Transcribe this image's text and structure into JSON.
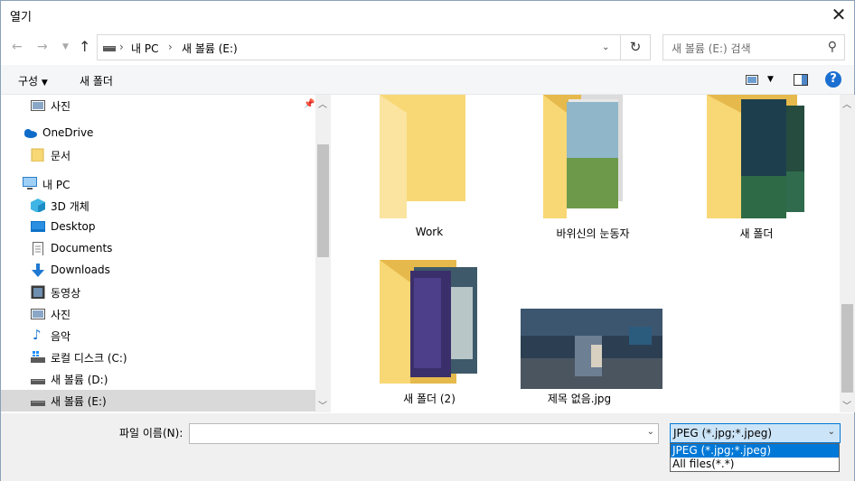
{
  "window": {
    "title": "열기"
  },
  "nav": {
    "breadcrumb": [
      "내 PC",
      "새 볼륨 (E:)"
    ],
    "search_placeholder": "새 볼륨 (E:) 검색"
  },
  "toolbar": {
    "organize": "구성",
    "new_folder": "새 폴더"
  },
  "sidebar": {
    "items": [
      {
        "label": "사진",
        "icon": "pictures-icon"
      },
      {
        "label": "OneDrive",
        "icon": "onedrive-icon"
      },
      {
        "label": "문서",
        "icon": "folder-icon"
      },
      {
        "label": "내 PC",
        "icon": "pc-icon"
      },
      {
        "label": "3D 개체",
        "icon": "3d-objects-icon"
      },
      {
        "label": "Desktop",
        "icon": "desktop-icon"
      },
      {
        "label": "Documents",
        "icon": "documents-icon"
      },
      {
        "label": "Downloads",
        "icon": "downloads-icon"
      },
      {
        "label": "동영상",
        "icon": "videos-icon"
      },
      {
        "label": "사진",
        "icon": "pictures-icon"
      },
      {
        "label": "음악",
        "icon": "music-icon"
      },
      {
        "label": "로컬 디스크 (C:)",
        "icon": "drive-c-icon"
      },
      {
        "label": "새 볼륨 (D:)",
        "icon": "drive-icon"
      },
      {
        "label": "새 볼륨 (E:)",
        "icon": "drive-icon"
      }
    ]
  },
  "files": [
    {
      "name": "Work",
      "type": "folder"
    },
    {
      "name": "바위신의 눈동자",
      "type": "folder"
    },
    {
      "name": "새 폴더",
      "type": "folder"
    },
    {
      "name": "새 폴더 (2)",
      "type": "folder"
    },
    {
      "name": "제목 없음.jpg",
      "type": "image"
    }
  ],
  "footer": {
    "filename_label": "파일 이름(N):",
    "filename_value": "",
    "filter_selected": "JPEG (*.jpg;*.jpeg)",
    "filter_options": [
      "JPEG (*.jpg;*.jpeg)",
      "All files(*.*)"
    ]
  },
  "colors": {
    "accent": "#0078d7",
    "folder": "#f8d775",
    "selected": "#d9d9d9"
  }
}
